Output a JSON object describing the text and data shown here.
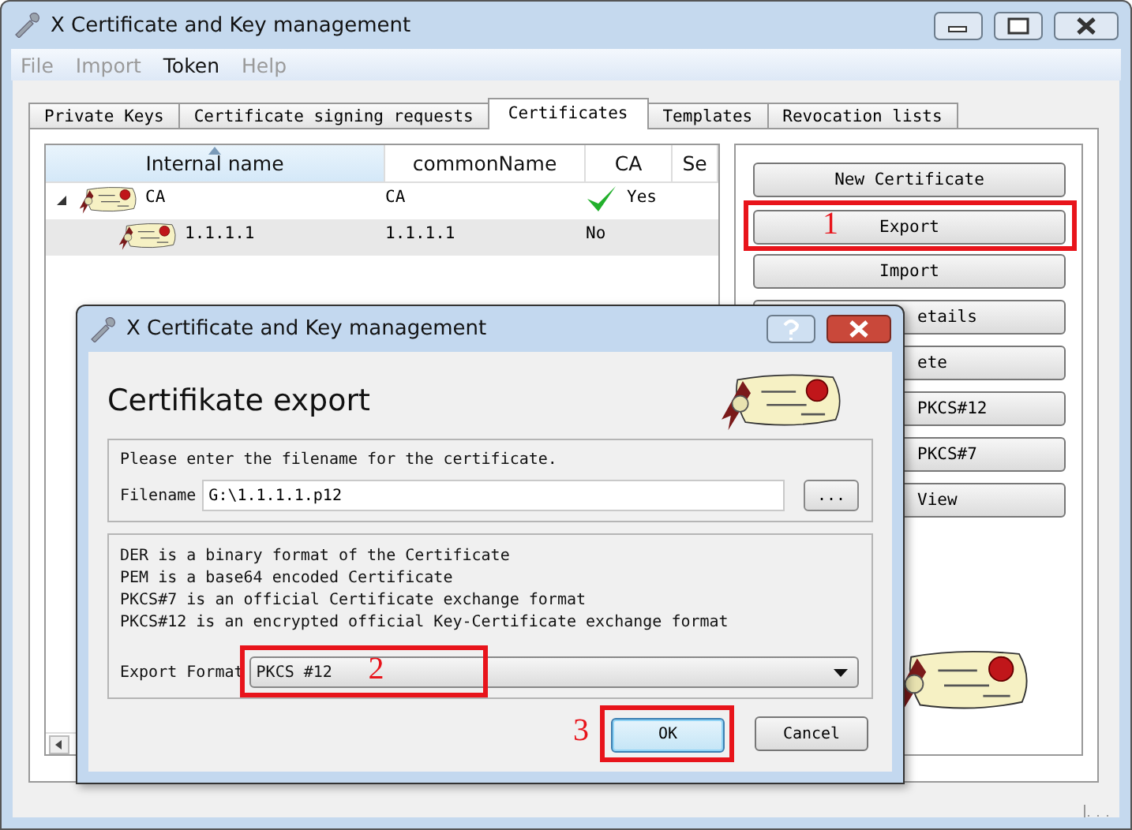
{
  "window": {
    "title": "X Certificate and Key management"
  },
  "menu": [
    {
      "label": "File",
      "disabled": true
    },
    {
      "label": "Import",
      "disabled": true
    },
    {
      "label": "Token",
      "disabled": false
    },
    {
      "label": "Help",
      "disabled": true
    }
  ],
  "tabs": [
    {
      "label": "Private Keys",
      "selected": false
    },
    {
      "label": "Certificate signing requests",
      "selected": false
    },
    {
      "label": "Certificates",
      "selected": true
    },
    {
      "label": "Templates",
      "selected": false
    },
    {
      "label": "Revocation lists",
      "selected": false
    }
  ],
  "tree": {
    "columns": [
      {
        "label": "Internal name",
        "sorted": true
      },
      {
        "label": "commonName",
        "sorted": false
      },
      {
        "label": "CA",
        "sorted": false
      },
      {
        "label": "Se",
        "sorted": false
      }
    ],
    "rows": [
      {
        "cells": [
          "CA",
          "CA",
          "Yes"
        ],
        "ca": true,
        "expanded": true,
        "selected": false,
        "children": [
          {
            "cells": [
              "1.1.1.1",
              "1.1.1.1",
              "No"
            ],
            "ca": false,
            "selected": true
          }
        ]
      }
    ]
  },
  "actions": [
    {
      "label": "New Certificate",
      "covered": false
    },
    {
      "label": "Export",
      "covered": false,
      "annotation": "1"
    },
    {
      "label": "Import",
      "covered": false
    },
    {
      "label": "etails",
      "covered": true
    },
    {
      "label": "ete",
      "covered": true
    },
    {
      "label": "PKCS#12",
      "covered": true
    },
    {
      "label": "PKCS#7",
      "covered": true
    },
    {
      "label": "View",
      "covered": true
    }
  ],
  "dialog": {
    "title": "X Certificate and Key management",
    "heading": "Certifikate export",
    "filename_prompt": "Please enter the filename for the certificate.",
    "filename_label": "Filename",
    "filename": "G:\\1.1.1.1.p12",
    "browse_button": "...",
    "format_notes": [
      "DER is a binary format of the Certificate",
      "PEM is a base64 encoded Certificate",
      "PKCS#7 is an official Certificate exchange format",
      "PKCS#12 is an encrypted official Key-Certificate exchange format"
    ],
    "format_label": "Export Format",
    "format": {
      "value": "PKCS #12",
      "annotation": "2"
    },
    "buttons": [
      {
        "label": "OK",
        "default": true,
        "annotation": "3"
      },
      {
        "label": "Cancel",
        "default": false
      }
    ]
  }
}
